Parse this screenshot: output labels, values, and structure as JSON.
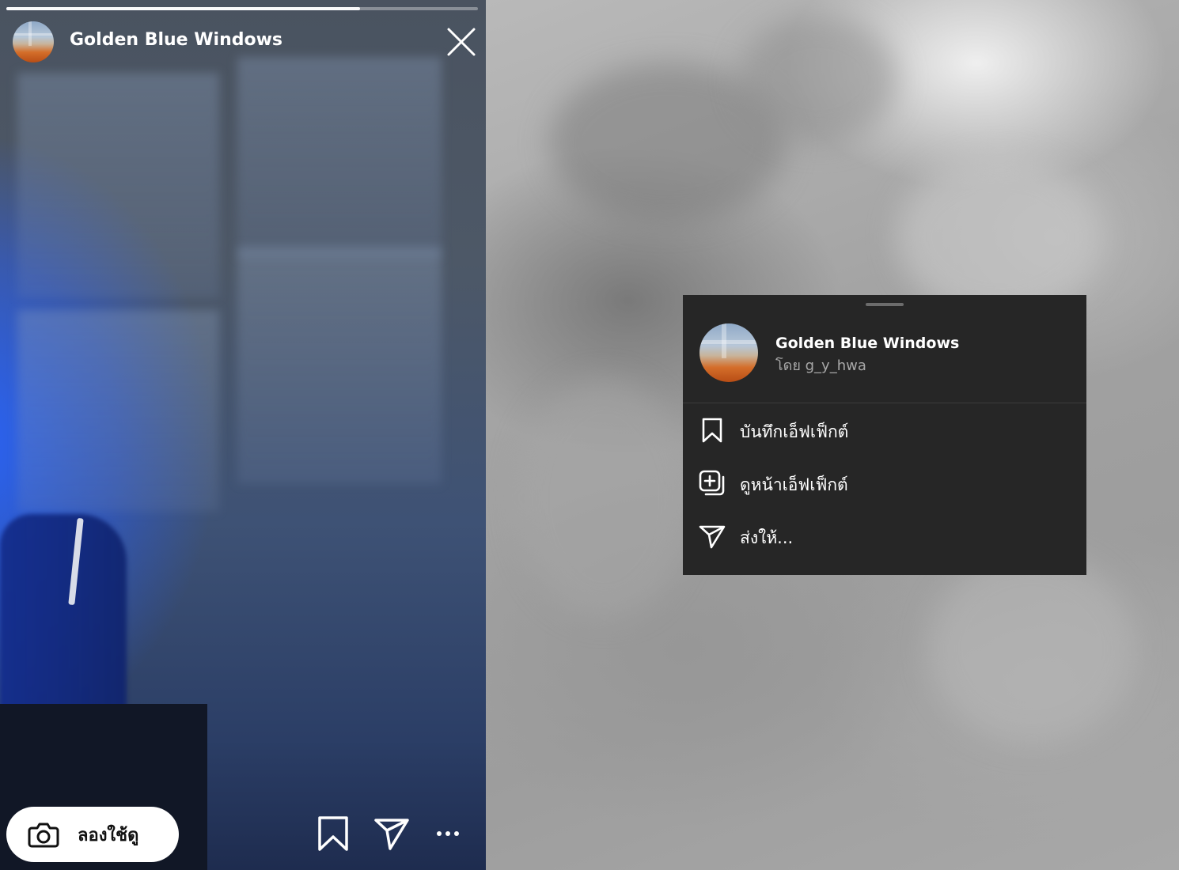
{
  "story": {
    "progress": 0.75,
    "title": "Golden Blue Windows",
    "try_button_label": "ลองใช้ดู"
  },
  "menu": {
    "effect_name": "Golden Blue Windows",
    "author": "โดย g_y_hwa",
    "items": [
      {
        "label": "บันทึกเอ็ฟเฟ็กต์",
        "icon": "bookmark-icon"
      },
      {
        "label": "ดูหน้าเอ็ฟเฟ็กต์",
        "icon": "effect-page-icon"
      },
      {
        "label": "ส่งให้...",
        "icon": "send-icon"
      }
    ]
  },
  "colors": {
    "sheet_background": "#262626",
    "secondary_text": "#a8a8a8"
  }
}
